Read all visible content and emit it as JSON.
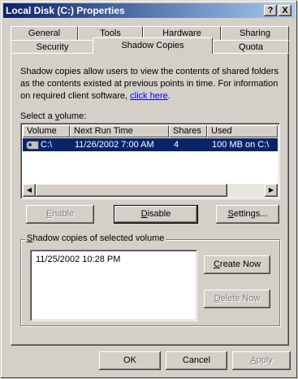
{
  "window": {
    "title": "Local Disk (C:) Properties",
    "help_label": "?",
    "close_label": "X"
  },
  "tabs": {
    "row_back": [
      "General",
      "Tools",
      "Hardware",
      "Sharing"
    ],
    "row_front": [
      "Security",
      "Shadow Copies",
      "Quota"
    ],
    "active": "Shadow Copies"
  },
  "description": {
    "text": "Shadow copies allow users to view the contents of shared folders as the contents existed at previous points in time. For information on required client software, ",
    "link": "click here",
    "end": "."
  },
  "volume_section": {
    "label_pre": "Select a ",
    "label_accel": "v",
    "label_post": "olume:"
  },
  "volume_table": {
    "columns": [
      "Volume",
      "Next Run Time",
      "Shares",
      "Used"
    ],
    "rows": [
      {
        "volume": "C:\\",
        "next_run": "11/26/2002 7:00 AM",
        "shares": "4",
        "used": "100 MB on C:\\",
        "icon": "drive-icon",
        "selected": true
      }
    ]
  },
  "volume_buttons": {
    "enable": {
      "pre": "",
      "accel": "E",
      "post": "nable",
      "disabled": true
    },
    "disable": {
      "pre": "",
      "accel": "D",
      "post": "isable",
      "disabled": false
    },
    "settings": {
      "pre": "",
      "accel": "S",
      "post": "ettings...",
      "disabled": false
    }
  },
  "copies_group": {
    "title_pre": "",
    "title_accel": "S",
    "title_post": "hadow copies of selected volume",
    "items": [
      "11/25/2002 10:28 PM"
    ],
    "create_now": {
      "pre": "",
      "accel": "C",
      "post": "reate Now",
      "disabled": false
    },
    "delete_now": {
      "pre": "",
      "accel": "D",
      "post": "elete Now",
      "disabled": true
    }
  },
  "dialog_buttons": {
    "ok": "OK",
    "cancel": "Cancel",
    "apply_pre": "",
    "apply_accel": "A",
    "apply_post": "pply",
    "apply_disabled": true
  },
  "colors": {
    "face": "#d4d0c8",
    "title_gradient_start": "#0a246a",
    "title_gradient_end": "#a6caf0",
    "selection": "#0a246a",
    "link": "#0000ff",
    "disabled_text": "#808080"
  }
}
